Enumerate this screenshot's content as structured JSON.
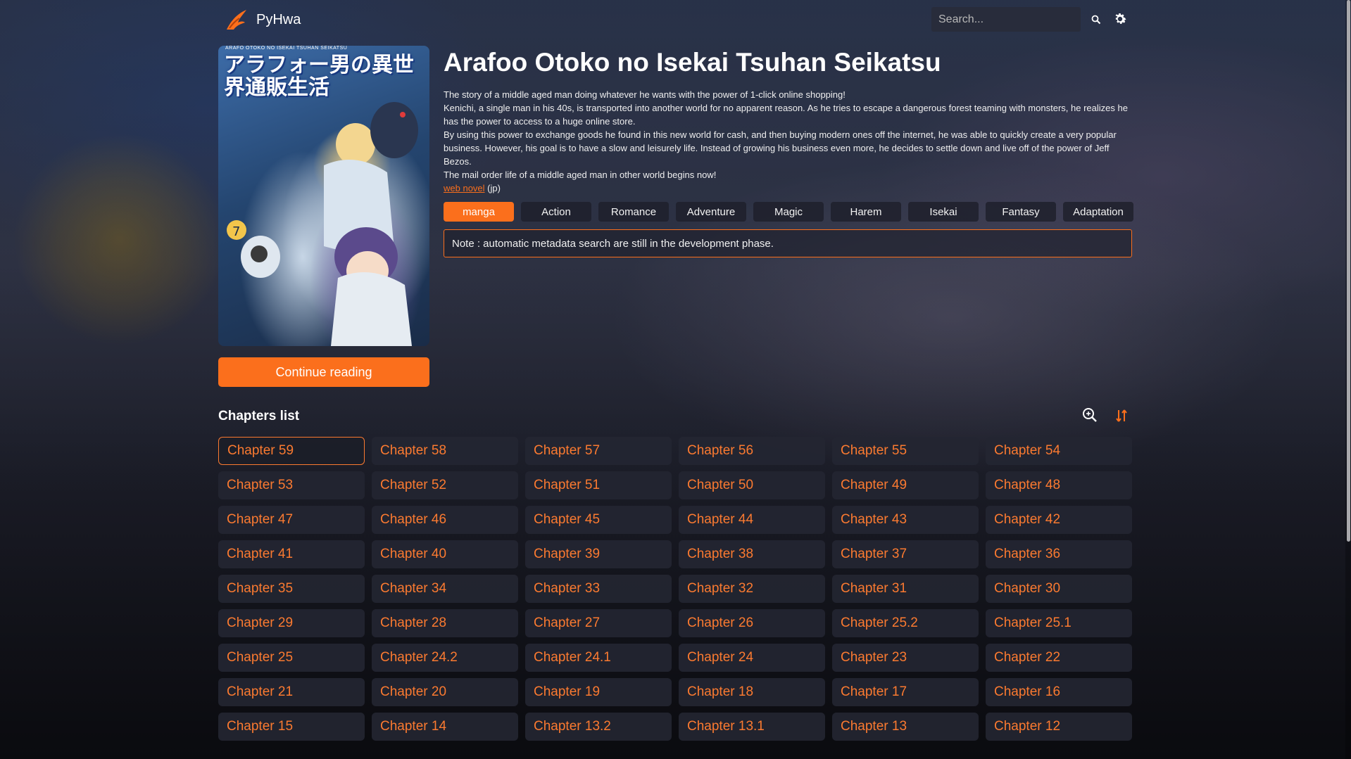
{
  "app": {
    "name": "PyHwa"
  },
  "search": {
    "placeholder": "Search..."
  },
  "manga": {
    "title": "Arafoo Otoko no Isekai Tsuhan Seikatsu",
    "cover": {
      "title_jp": "アラフォー男の異世界通販生活",
      "title_en": "ARAFO OTOKO NO ISEKAI TSUHAN SEIKATSU"
    },
    "description": [
      "The story of a middle aged man doing whatever he wants with the power of 1-click online shopping!",
      "Kenichi, a single man in his 40s, is transported into another world for no apparent reason. As he tries to escape a dangerous forest teaming with monsters, he realizes he has the power to access to a huge online store.",
      "By using this power to exchange goods he found in this new world for cash, and then buying modern ones off the internet, he was able to quickly create a very popular business. However, his goal is to have a slow and leisurely life. Instead of growing his business even more, he decides to settle down and live off of the power of Jeff Bezos.",
      "The mail order life of a middle aged man in other world begins now!"
    ],
    "link_text": "web novel",
    "link_suffix": " (jp)",
    "tags": [
      "manga",
      "Action",
      "Romance",
      "Adventure",
      "Magic",
      "Harem",
      "Isekai",
      "Fantasy",
      "Adaptation"
    ],
    "active_tag": "manga",
    "note": "Note : automatic metadata search are still in the development phase.",
    "continue_label": "Continue reading"
  },
  "chapters": {
    "heading": "Chapters list",
    "current": "Chapter 59",
    "items": [
      "Chapter 59",
      "Chapter 58",
      "Chapter 57",
      "Chapter 56",
      "Chapter 55",
      "Chapter 54",
      "Chapter 53",
      "Chapter 52",
      "Chapter 51",
      "Chapter 50",
      "Chapter 49",
      "Chapter 48",
      "Chapter 47",
      "Chapter 46",
      "Chapter 45",
      "Chapter 44",
      "Chapter 43",
      "Chapter 42",
      "Chapter 41",
      "Chapter 40",
      "Chapter 39",
      "Chapter 38",
      "Chapter 37",
      "Chapter 36",
      "Chapter 35",
      "Chapter 34",
      "Chapter 33",
      "Chapter 32",
      "Chapter 31",
      "Chapter 30",
      "Chapter 29",
      "Chapter 28",
      "Chapter 27",
      "Chapter 26",
      "Chapter 25.2",
      "Chapter 25.1",
      "Chapter 25",
      "Chapter 24.2",
      "Chapter 24.1",
      "Chapter 24",
      "Chapter 23",
      "Chapter 22",
      "Chapter 21",
      "Chapter 20",
      "Chapter 19",
      "Chapter 18",
      "Chapter 17",
      "Chapter 16",
      "Chapter 15",
      "Chapter 14",
      "Chapter 13.2",
      "Chapter 13.1",
      "Chapter 13",
      "Chapter 12"
    ]
  },
  "colors": {
    "accent": "#fb6f1c",
    "chapter_text": "#fb7a30",
    "card_bg": "#24263a"
  }
}
